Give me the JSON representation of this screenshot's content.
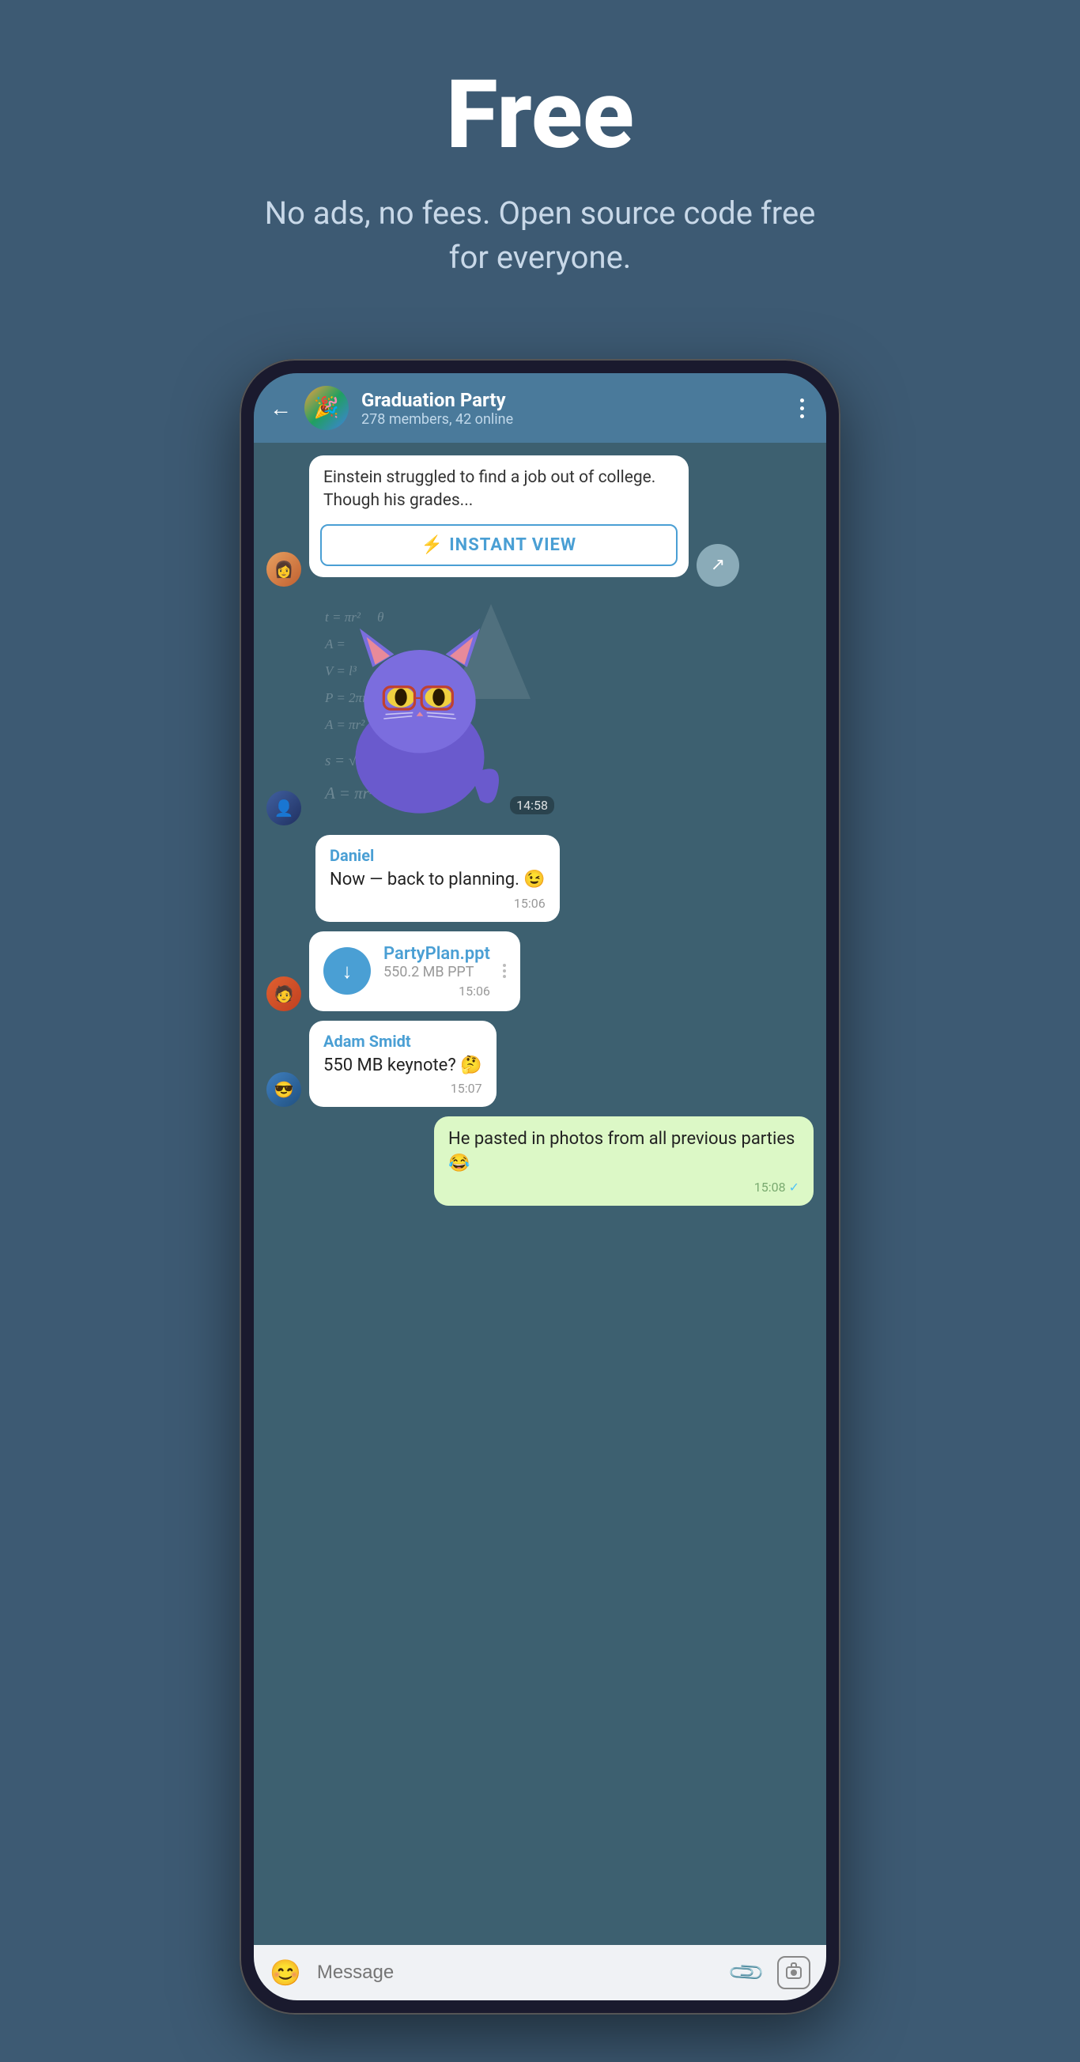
{
  "hero": {
    "title": "Free",
    "subtitle": "No ads, no fees. Open source code free for everyone."
  },
  "chat": {
    "back_label": "←",
    "group_name": "Graduation Party",
    "group_meta": "278 members, 42 online",
    "more_icon": "⋮"
  },
  "messages": [
    {
      "id": "article",
      "type": "article",
      "text": "Einstein struggled to find a job out of college. Though his grades...",
      "instant_view_label": "INSTANT VIEW",
      "avatar_type": "girl"
    },
    {
      "id": "sticker",
      "type": "sticker",
      "time": "14:58",
      "avatar_type": "boy1"
    },
    {
      "id": "msg1",
      "type": "text",
      "sender": "Daniel",
      "text": "Now — back to planning. 😉",
      "time": "15:06",
      "avatar_type": "none"
    },
    {
      "id": "file1",
      "type": "file",
      "filename": "PartyPlan.ppt",
      "filesize": "550.2 MB PPT",
      "time": "15:06",
      "avatar_type": "boy2"
    },
    {
      "id": "msg2",
      "type": "text",
      "sender": "Adam Smidt",
      "text": "550 MB keynote? 🤔",
      "time": "15:07",
      "avatar_type": "boy3"
    },
    {
      "id": "msg3",
      "type": "text_outgoing",
      "text": "He pasted in photos from all previous parties 😂",
      "time": "15:08",
      "avatar_type": "none"
    }
  ],
  "input_bar": {
    "placeholder": "Message",
    "emoji_icon": "😊",
    "attach_icon": "📎",
    "camera_icon": "📷"
  },
  "math_formulas": [
    "t = πr²",
    "A =",
    "V = l³",
    "P = 2πr",
    "A = πr²",
    "s = √r² + h²",
    "A = πr² + πrs"
  ]
}
